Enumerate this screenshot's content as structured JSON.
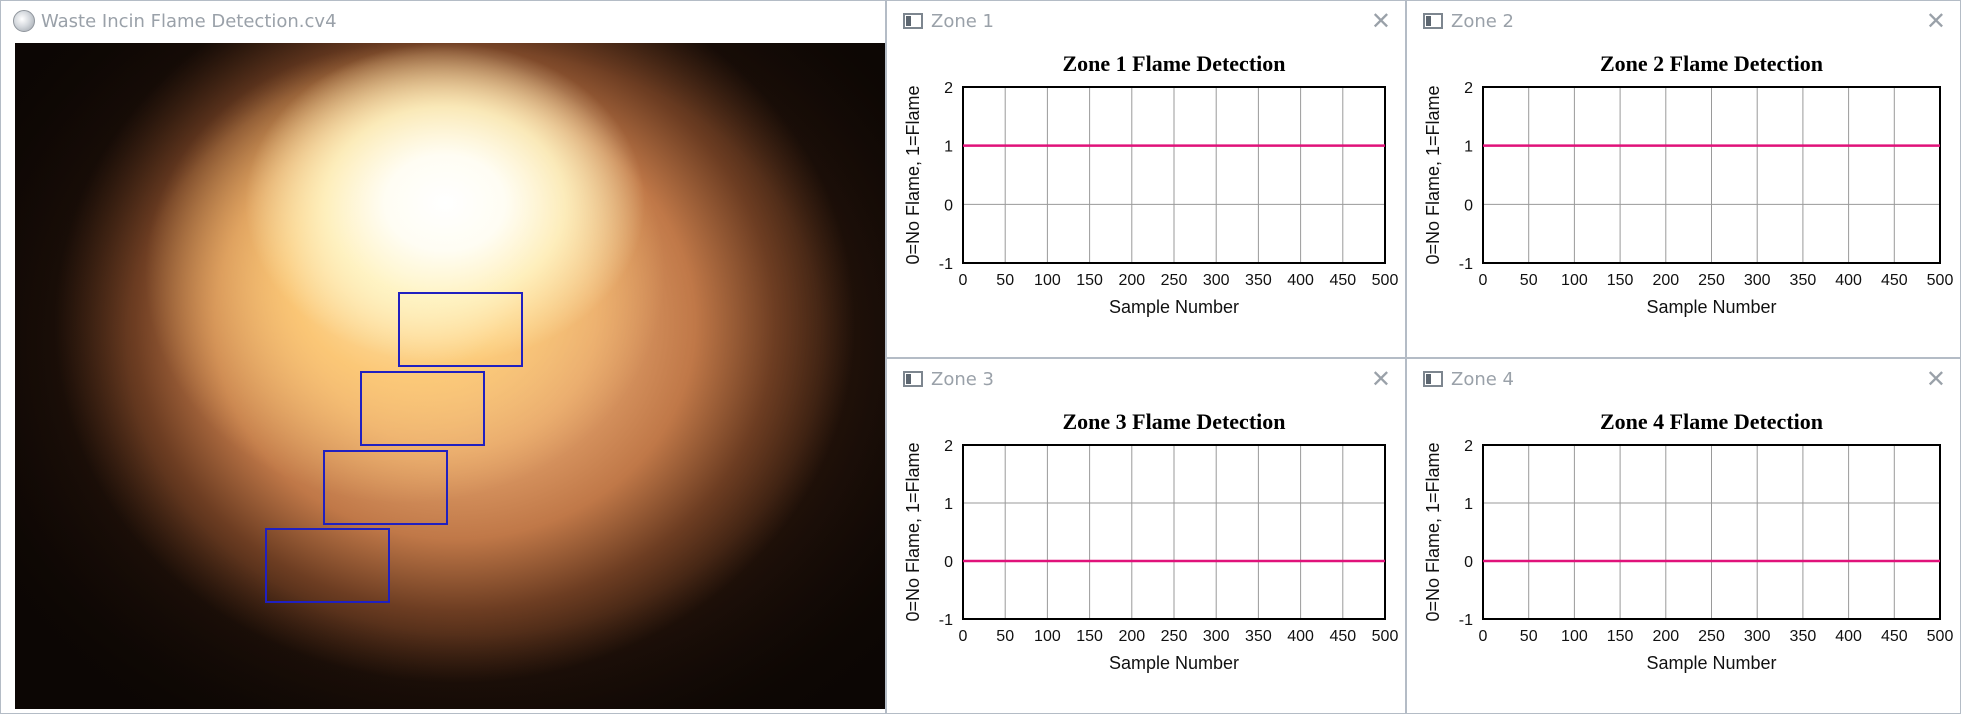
{
  "camera_window": {
    "title": "Waste Incin Flame Detection.cv4",
    "icon": "camera-app-icon",
    "roi_color": "#2020c0"
  },
  "zones": [
    {
      "window_title": "Zone 1",
      "close_glyph": "✕",
      "chart_data": {
        "type": "line",
        "title": "Zone 1 Flame Detection",
        "xlabel": "Sample Number",
        "ylabel": "0=No Flame, 1=Flame",
        "xlim": [
          0,
          500
        ],
        "ylim": [
          -1,
          2
        ],
        "xticks": [
          "0",
          "50",
          "100",
          "150",
          "200",
          "250",
          "300",
          "350",
          "400",
          "450",
          "500"
        ],
        "yticks": [
          "2",
          "1",
          "0",
          "-1"
        ],
        "grid": true,
        "series_color": "#e0127a",
        "x": [
          0,
          500
        ],
        "values": [
          1,
          1
        ]
      }
    },
    {
      "window_title": "Zone 2",
      "close_glyph": "✕",
      "chart_data": {
        "type": "line",
        "title": "Zone 2 Flame Detection",
        "xlabel": "Sample Number",
        "ylabel": "0=No Flame, 1=Flame",
        "xlim": [
          0,
          500
        ],
        "ylim": [
          -1,
          2
        ],
        "xticks": [
          "0",
          "50",
          "100",
          "150",
          "200",
          "250",
          "300",
          "350",
          "400",
          "450",
          "500"
        ],
        "yticks": [
          "2",
          "1",
          "0",
          "-1"
        ],
        "grid": true,
        "series_color": "#e0127a",
        "x": [
          0,
          500
        ],
        "values": [
          1,
          1
        ]
      }
    },
    {
      "window_title": "Zone 3",
      "close_glyph": "✕",
      "chart_data": {
        "type": "line",
        "title": "Zone 3 Flame Detection",
        "xlabel": "Sample Number",
        "ylabel": "0=No Flame, 1=Flame",
        "xlim": [
          0,
          500
        ],
        "ylim": [
          -1,
          2
        ],
        "xticks": [
          "0",
          "50",
          "100",
          "150",
          "200",
          "250",
          "300",
          "350",
          "400",
          "450",
          "500"
        ],
        "yticks": [
          "2",
          "1",
          "0",
          "-1"
        ],
        "grid": true,
        "series_color": "#e0127a",
        "x": [
          0,
          500
        ],
        "values": [
          0,
          0
        ]
      }
    },
    {
      "window_title": "Zone 4",
      "close_glyph": "✕",
      "chart_data": {
        "type": "line",
        "title": "Zone 4 Flame Detection",
        "xlabel": "Sample Number",
        "ylabel": "0=No Flame, 1=Flame",
        "xlim": [
          0,
          500
        ],
        "ylim": [
          -1,
          2
        ],
        "xticks": [
          "0",
          "50",
          "100",
          "150",
          "200",
          "250",
          "300",
          "350",
          "400",
          "450",
          "500"
        ],
        "yticks": [
          "2",
          "1",
          "0",
          "-1"
        ],
        "grid": true,
        "series_color": "#e0127a",
        "x": [
          0,
          500
        ],
        "values": [
          0,
          0
        ]
      }
    }
  ]
}
